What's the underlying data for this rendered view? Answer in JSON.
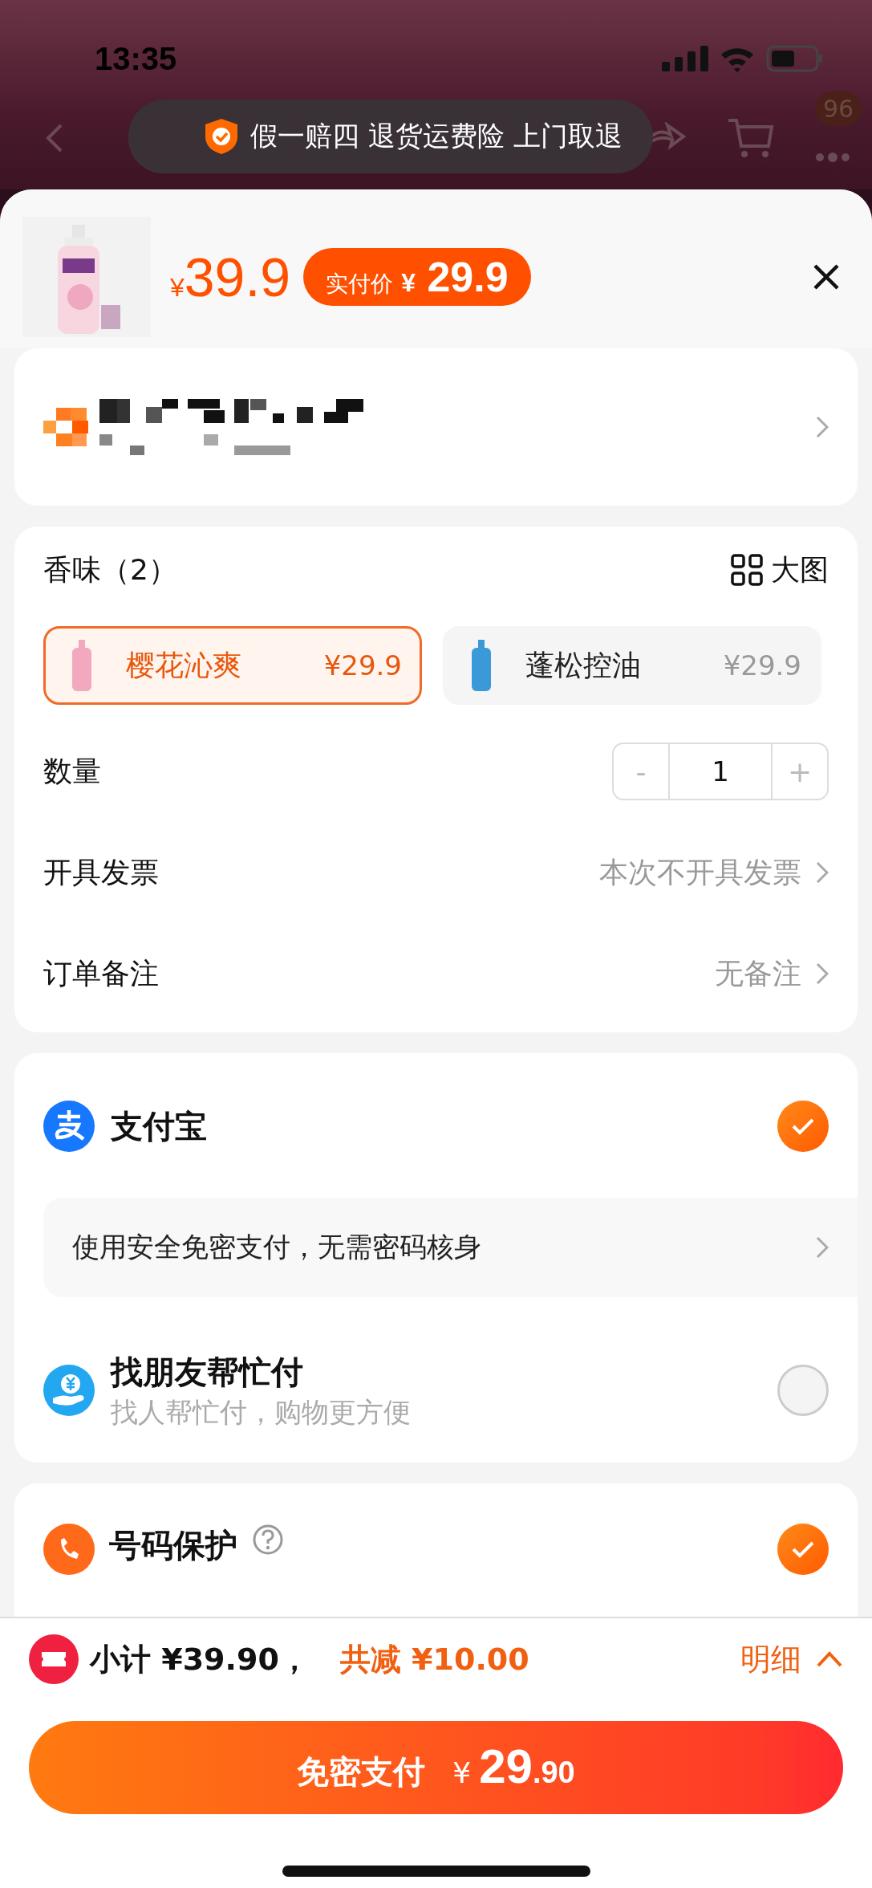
{
  "status_bar": {
    "time": "13:35"
  },
  "toast": {
    "text": "假一赔四 退货运费险 上门取退"
  },
  "nav": {
    "cart_badge": "96"
  },
  "product": {
    "currency": "¥",
    "price": "39.9",
    "final_label": "实付价",
    "final_currency": "¥",
    "final_price": "29.9"
  },
  "spec": {
    "title": "香味（2）",
    "big_image": "大图",
    "options": [
      {
        "name": "樱花沁爽",
        "price": "¥29.9",
        "selected": true,
        "color": "#f2a9c0"
      },
      {
        "name": "蓬松控油",
        "price": "¥29.9",
        "selected": false,
        "color": "#3a9ad8"
      }
    ]
  },
  "quantity": {
    "label": "数量",
    "minus": "-",
    "value": "1",
    "plus": "+"
  },
  "rows": [
    {
      "label": "开具发票",
      "value": "本次不开具发票"
    },
    {
      "label": "订单备注",
      "value": "无备注"
    }
  ],
  "payments": [
    {
      "kind": "alipay",
      "name": "支付宝",
      "selected": true,
      "promo": "使用安全免密支付，无需密码核身"
    },
    {
      "kind": "friend",
      "name": "找朋友帮忙付",
      "subtitle": "找人帮忙付，购物更方便",
      "selected": false
    }
  ],
  "protection": {
    "title": "号码保护",
    "checked": true
  },
  "summary": {
    "subtotal": "小计 ¥39.90，",
    "discount": "共减 ¥10.00",
    "detail": "明细"
  },
  "pay_button": {
    "label": "免密支付",
    "currency": "¥",
    "amount": "29",
    "decimals": ".90"
  }
}
